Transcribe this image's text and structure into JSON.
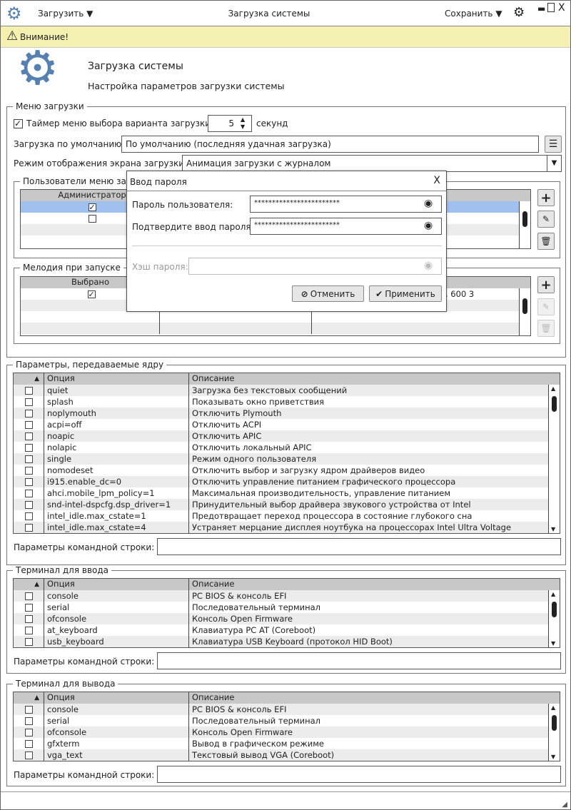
{
  "titlebar": {
    "load_menu": "Загрузить",
    "title": "Загрузка системы",
    "save_menu": "Сохранить"
  },
  "warning": {
    "text": "Внимание!"
  },
  "header": {
    "title": "Загрузка системы",
    "subtitle": "Настройка параметров загрузки системы"
  },
  "boot_menu": {
    "legend": "Меню загрузки",
    "timer_label": "Таймер меню выбора варианта загрузки:",
    "timer_value": "5",
    "timer_unit": "секунд",
    "timer_checked": true,
    "default_label": "Загрузка по умолчанию:",
    "default_value": "По умолчанию (последняя удачная загрузка)",
    "mode_label": "Режим отображения экрана загрузки:",
    "mode_value": "Анимация загрузки с журналом",
    "users": {
      "legend": "Пользователи меню загрузки",
      "column": "Администратор",
      "rows": [
        true,
        false
      ]
    },
    "melody": {
      "legend": "Мелодия при запуске",
      "column": "Выбрано",
      "partial_value": ". 600 3",
      "rows": [
        true
      ]
    }
  },
  "dialog": {
    "title": "Ввод пароля",
    "password_label": "Пароль пользователя:",
    "password_value": "************************",
    "confirm_label": "Подтвердите ввод пароля:",
    "confirm_value": "************************",
    "hash_label": "Хэш пароля:",
    "hash_value": "",
    "cancel": "Отменить",
    "apply": "Применить"
  },
  "kernel": {
    "legend": "Параметры, передаваемые ядру",
    "col_option": "Опция",
    "col_desc": "Описание",
    "cmdline_label": "Параметры командной строки:",
    "cmdline_value": "",
    "rows": [
      [
        "quiet",
        "Загрузка без текстовых сообщений"
      ],
      [
        "splash",
        "Показывать окно приветствия"
      ],
      [
        "noplymouth",
        "Отключить Plymouth"
      ],
      [
        "acpi=off",
        "Отключить ACPI"
      ],
      [
        "noapic",
        "Отключить APIC"
      ],
      [
        "nolapic",
        "Отключить локальный APIC"
      ],
      [
        "single",
        "Режим одного пользователя"
      ],
      [
        "nomodeset",
        "Отключить выбор и загрузку ядром драйверов видео"
      ],
      [
        "i915.enable_dc=0",
        "Отключить управление питанием графического процессора"
      ],
      [
        "ahci.mobile_lpm_policy=1",
        "Максимальная производительность, управление питанием"
      ],
      [
        "snd-intel-dspcfg.dsp_driver=1",
        "Принудительный выбор драйвера звукового устройства от Intel"
      ],
      [
        "intel_idle.max_cstate=1",
        "Предотвращает переход процессора в состояние глубокого сна"
      ],
      [
        "intel_idle.max_cstate=4",
        "Устраняет мерцание дисплея ноутбука на процессорах Intel Ultra Voltage"
      ]
    ]
  },
  "term_in": {
    "legend": "Терминал для ввода",
    "col_option": "Опция",
    "col_desc": "Описание",
    "cmdline_label": "Параметры командной строки:",
    "cmdline_value": "",
    "rows": [
      [
        "console",
        "PC BIOS & консоль EFI"
      ],
      [
        "serial",
        "Последовательный терминал"
      ],
      [
        "ofconsole",
        "Консоль Open Firmware"
      ],
      [
        "at_keyboard",
        "Клавиатура PC AT (Coreboot)"
      ],
      [
        "usb_keyboard",
        "Клавиатура USB Keyboard (протокол HID Boot)"
      ]
    ]
  },
  "term_out": {
    "legend": "Терминал для вывода",
    "col_option": "Опция",
    "col_desc": "Описание",
    "cmdline_label": "Параметры командной строки:",
    "cmdline_value": "",
    "rows": [
      [
        "console",
        "PC BIOS & консоль EFI"
      ],
      [
        "serial",
        "Последовательный терминал"
      ],
      [
        "ofconsole",
        "Консоль Open Firmware"
      ],
      [
        "gfxterm",
        "Вывод в графическом режиме"
      ],
      [
        "vga_text",
        "Текстовый вывод VGA (Coreboot)"
      ]
    ]
  },
  "colors": {
    "accent": "#5580b0",
    "warning_bg": "#f3f0b0",
    "selection": "#a0c0f0"
  }
}
